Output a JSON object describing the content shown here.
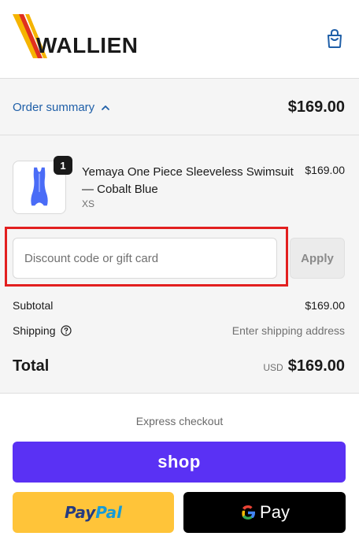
{
  "brand": {
    "name": "WALLIEN",
    "logo_colors": [
      "#f5b400",
      "#e0301e"
    ]
  },
  "header": {
    "cart_icon": "shopping-bag-icon"
  },
  "order_summary": {
    "toggle_label": "Order summary",
    "toggle_icon": "chevron-up-icon",
    "total": "$169.00"
  },
  "line_item": {
    "quantity": "1",
    "name": "Yemaya One Piece Sleeveless Swimsuit — Cobalt Blue",
    "variant": "XS",
    "price": "$169.00",
    "swatch_color": "#4a6cf7"
  },
  "discount": {
    "placeholder": "Discount code or gift card",
    "value": "",
    "apply_label": "Apply",
    "highlight_color": "#e21f1f"
  },
  "totals": {
    "subtotal_label": "Subtotal",
    "subtotal_value": "$169.00",
    "shipping_label": "Shipping",
    "shipping_icon": "help-circle-icon",
    "shipping_value": "Enter shipping address",
    "total_label": "Total",
    "currency": "USD",
    "total_value": "$169.00"
  },
  "express": {
    "title": "Express checkout",
    "shop_label": "shop",
    "shop_color": "#5a31f4",
    "paypal_part1": "Pay",
    "paypal_part2": "Pal",
    "paypal_color": "#ffc439",
    "gpay_label": "Pay",
    "gpay_color": "#000000"
  }
}
